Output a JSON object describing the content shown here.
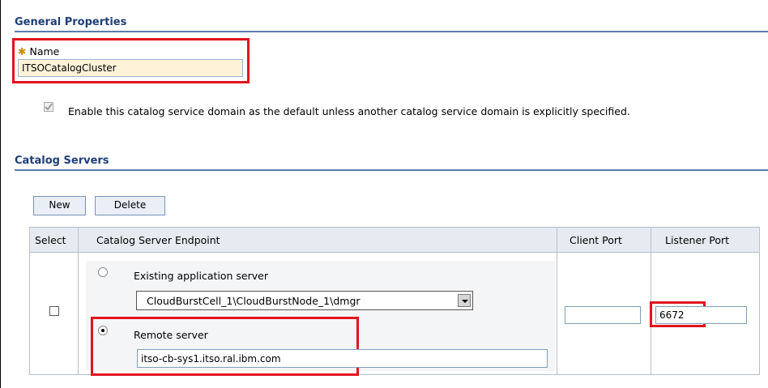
{
  "general": {
    "title": "General Properties",
    "name_label": "Name",
    "name_value": "ITSOCatalogCluster",
    "default_checkbox_checked": true,
    "default_text": "Enable this catalog service domain as the default unless another catalog service domain is explicitly specified."
  },
  "catalog": {
    "title": "Catalog Servers",
    "new_label": "New",
    "delete_label": "Delete",
    "columns": {
      "select": "Select",
      "endpoint": "Catalog Server Endpoint",
      "client_port": "Client Port",
      "listener_port": "Listener Port"
    },
    "row": {
      "selected": false,
      "existing_label": "Existing application server",
      "existing_server": "CloudBurstCell_1\\CloudBurstNode_1\\dmgr",
      "remote_label": "Remote server",
      "remote_value": "itso-cb-sys1.itso.ral.ibm.com",
      "endpoint_choice": "remote",
      "client_port": "",
      "listener_port": "6672"
    }
  },
  "colors": {
    "section_title": "#1f3e78",
    "highlight": "#e0141e",
    "name_field_bg": "#fdf3d9"
  }
}
